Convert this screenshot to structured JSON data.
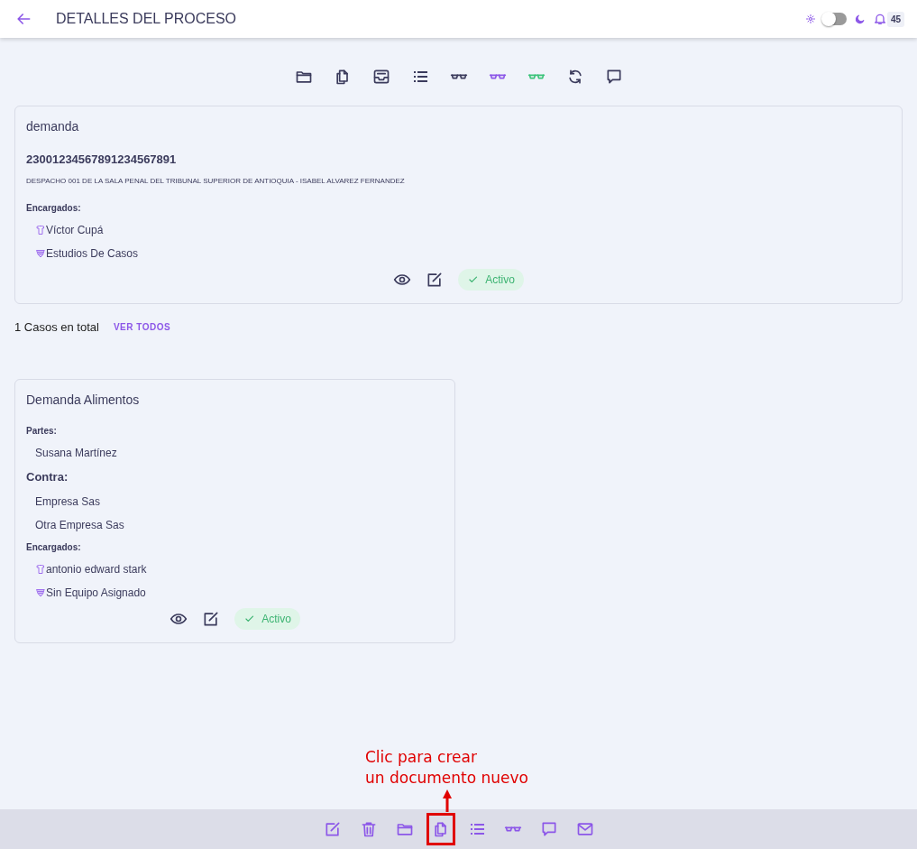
{
  "header": {
    "title": "DETALLES DEL PROCESO",
    "dark_mode": false,
    "notification_count": "45"
  },
  "toolbar": [
    {
      "kind": "folder",
      "color": "#3b3b5c"
    },
    {
      "kind": "documents",
      "color": "#3b3b5c"
    },
    {
      "kind": "inbox",
      "color": "#3b3b5c"
    },
    {
      "kind": "list",
      "color": "#3b3b5c"
    },
    {
      "kind": "glasses",
      "color": "#3b3b5c"
    },
    {
      "kind": "glasses",
      "color": "#8c57e8"
    },
    {
      "kind": "glasses",
      "color": "#3cc47a"
    },
    {
      "kind": "refresh",
      "color": "#3b3b5c"
    },
    {
      "kind": "chat",
      "color": "#3b3b5c"
    }
  ],
  "process": {
    "title": "demanda",
    "number": "23001234567891234567891",
    "court": "DESPACHO 001 DE LA SALA PENAL DEL TRIBUNAL SUPERIOR DE ANTIOQUIA - ISABEL ALVAREZ FERNANDEZ",
    "assignees_label": "Encargados:",
    "assignees": [
      {
        "kind": "person",
        "name": "Víctor Cupá"
      },
      {
        "kind": "team",
        "name": "Estudios De Casos"
      }
    ],
    "status": "Activo"
  },
  "summary": {
    "count": "1 Casos en total",
    "link": "VER TODOS"
  },
  "cases": [
    {
      "title": "Demanda Alimentos",
      "parties_label": "Partes:",
      "parties": [
        "Susana Martínez"
      ],
      "against_label": "Contra:",
      "against": [
        "Empresa Sas",
        "Otra Empresa Sas"
      ],
      "assignees_label": "Encargados:",
      "assignees": [
        {
          "kind": "person",
          "name": "antonio edward stark"
        },
        {
          "kind": "team",
          "name": "Sin Equipo Asignado"
        }
      ],
      "status": "Activo"
    }
  ],
  "bottom_toolbar": [
    {
      "kind": "edit",
      "highlighted": false
    },
    {
      "kind": "trash",
      "highlighted": false
    },
    {
      "kind": "folder",
      "highlighted": false
    },
    {
      "kind": "documents",
      "highlighted": true
    },
    {
      "kind": "list",
      "highlighted": false
    },
    {
      "kind": "glasses",
      "highlighted": false
    },
    {
      "kind": "chat",
      "highlighted": false
    },
    {
      "kind": "mail",
      "highlighted": false
    }
  ],
  "annotation": {
    "lines": [
      "Clic para crear",
      "un documento nuevo"
    ]
  }
}
